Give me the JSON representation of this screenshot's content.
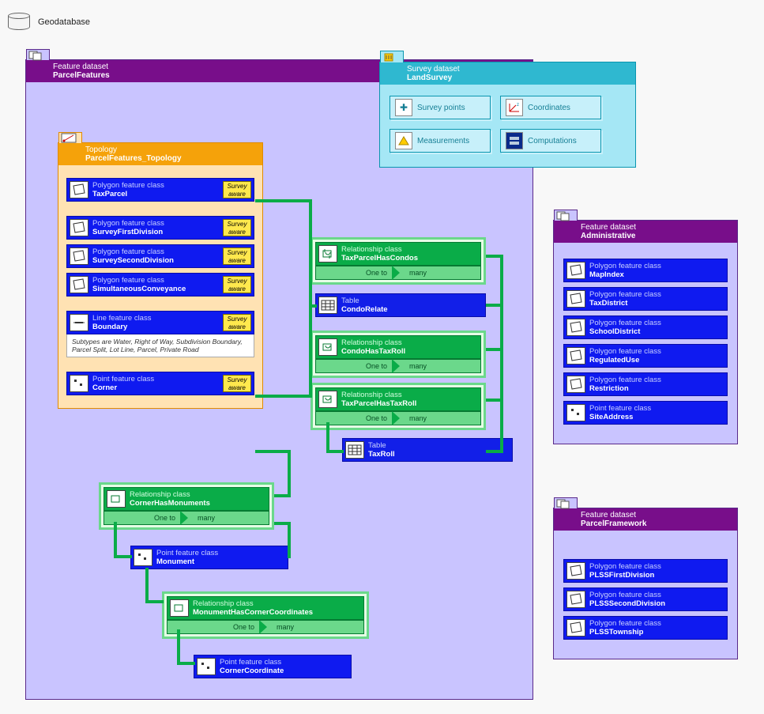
{
  "root_label": "Geodatabase",
  "survey_aware_tag": "Survey aware",
  "card_one": "One to",
  "card_many": "many",
  "survey_dataset": {
    "type": "Survey dataset",
    "name": "LandSurvey",
    "items": [
      {
        "label": "Survey points"
      },
      {
        "label": "Coordinates"
      },
      {
        "label": "Measurements"
      },
      {
        "label": "Computations"
      }
    ]
  },
  "parcel_features": {
    "type": "Feature dataset",
    "name": "ParcelFeatures",
    "topology": {
      "type": "Topology",
      "name": "ParcelFeatures_Topology",
      "items": [
        {
          "sup": "Polygon feature class",
          "name": "TaxParcel",
          "survey_aware": true,
          "icon": "polygon"
        },
        {
          "sup": "Polygon feature class",
          "name": "SurveyFirstDivision",
          "survey_aware": true,
          "icon": "polygon"
        },
        {
          "sup": "Polygon feature class",
          "name": "SurveySecondDivision",
          "survey_aware": true,
          "icon": "polygon"
        },
        {
          "sup": "Polygon feature class",
          "name": "SimultaneousConveyance",
          "survey_aware": true,
          "icon": "polygon"
        },
        {
          "sup": "Line feature class",
          "name": "Boundary",
          "survey_aware": true,
          "icon": "line",
          "note": "Subtypes are Water, Right of Way, Subdivision Boundary, Parcel Split, Lot Line, Parcel, Private Road"
        },
        {
          "sup": "Point feature class",
          "name": "Corner",
          "survey_aware": true,
          "icon": "point"
        }
      ]
    },
    "relations": [
      {
        "sup": "Relationship class",
        "name": "TaxParcelHasCondos"
      },
      {
        "sup": "Relationship class",
        "name": "CondoHasTaxRoll"
      },
      {
        "sup": "Relationship class",
        "name": "TaxParcelHasTaxRoll"
      },
      {
        "sup": "Relationship class",
        "name": "CornerHasMonuments"
      },
      {
        "sup": "Relationship class",
        "name": "MonumentHasCornerCoordinates"
      }
    ],
    "tables": [
      {
        "sup": "Table",
        "name": "CondoRelate"
      },
      {
        "sup": "Table",
        "name": "TaxRoll"
      }
    ],
    "low_fc": [
      {
        "sup": "Point feature class",
        "name": "Monument",
        "icon": "point"
      },
      {
        "sup": "Point feature class",
        "name": "CornerCoordinate",
        "icon": "point"
      }
    ]
  },
  "administrative": {
    "type": "Feature dataset",
    "name": "Administrative",
    "items": [
      {
        "sup": "Polygon feature class",
        "name": "MapIndex",
        "icon": "polygon"
      },
      {
        "sup": "Polygon feature class",
        "name": "TaxDistrict",
        "icon": "polygon"
      },
      {
        "sup": "Polygon feature class",
        "name": "SchoolDistrict",
        "icon": "polygon"
      },
      {
        "sup": "Polygon feature class",
        "name": "RegulatedUse",
        "icon": "polygon"
      },
      {
        "sup": "Polygon feature class",
        "name": "Restriction",
        "icon": "polygon"
      },
      {
        "sup": "Point feature class",
        "name": "SiteAddress",
        "icon": "point"
      }
    ]
  },
  "parcel_framework": {
    "type": "Feature dataset",
    "name": "ParcelFramework",
    "items": [
      {
        "sup": "Polygon feature class",
        "name": "PLSSFirstDivision",
        "icon": "polygon"
      },
      {
        "sup": "Polygon feature class",
        "name": "PLSSSecondDivision",
        "icon": "polygon"
      },
      {
        "sup": "Polygon feature class",
        "name": "PLSSTownship",
        "icon": "polygon"
      }
    ]
  }
}
